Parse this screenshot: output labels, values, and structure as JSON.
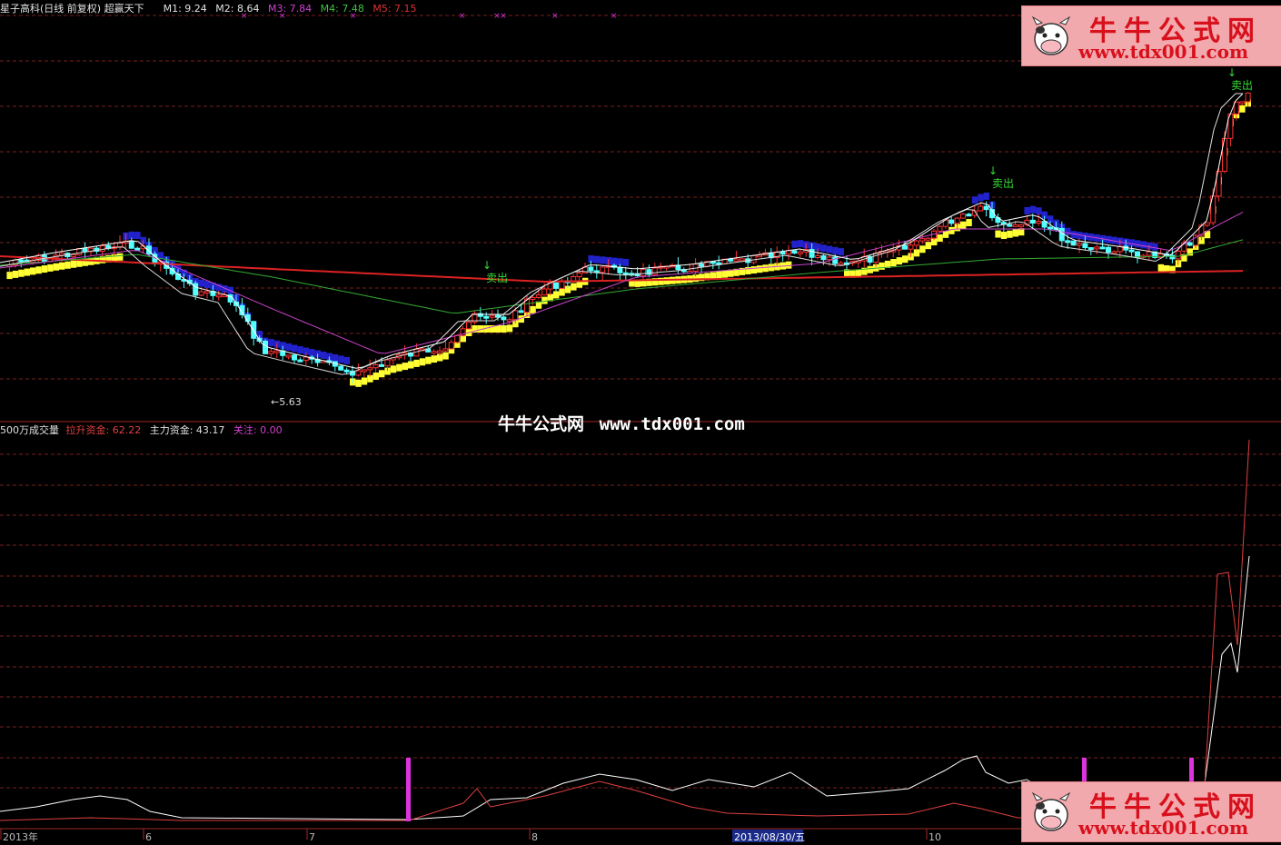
{
  "header": {
    "stock": "星子高科(日线 前复权) 超赢天下",
    "ma": [
      {
        "label": "M1: 9.24",
        "color": "#e0e0e0"
      },
      {
        "label": "M2: 8.64",
        "color": "#e0e0e0"
      },
      {
        "label": "M3: 7.84",
        "color": "#d040d0"
      },
      {
        "label": "M4: 7.48",
        "color": "#40c040"
      },
      {
        "label": "M5: 7.15",
        "color": "#e03030"
      }
    ]
  },
  "sub_header": {
    "name": "500万成交量",
    "items": [
      {
        "label": "拉升资金: 62.22",
        "color": "#e04040"
      },
      {
        "label": "主力资金: 43.17",
        "color": "#e0e0e0"
      },
      {
        "label": "关注: 0.00",
        "color": "#d040d0"
      }
    ]
  },
  "x_axis": {
    "labels": [
      "2013年",
      "6",
      "7",
      "8",
      "10"
    ],
    "cursor_label": "2013/08/30/五"
  },
  "annotations": {
    "sell": "卖出",
    "low_price": "5.63"
  },
  "watermark": {
    "logo_title": "牛牛公式网",
    "logo_url": "www.tdx001.com",
    "center_text": "牛牛公式网",
    "center_url": "www.tdx001.com"
  },
  "colors": {
    "up": "#ff3232",
    "down": "#54ffff",
    "rise_band": "#ffff33",
    "fall_band": "#2222cc",
    "grid": "#7a1f1f",
    "ma_long": "#dd2222",
    "ma_mid": "#33aa33",
    "ma_short": "#cc44cc"
  },
  "chart_data": {
    "type": "candlestick+line",
    "price_panel": {
      "ma_latest": {
        "M1": 9.24,
        "M2": 8.64,
        "M3": 7.84,
        "M4": 7.48,
        "M5": 7.15
      },
      "annotated_low": 5.63,
      "sell_signals": 3
    },
    "indicator_panel": {
      "name": "500万成交量",
      "series": [
        {
          "name": "拉升资金",
          "latest": 62.22
        },
        {
          "name": "主力资金",
          "latest": 43.17
        },
        {
          "name": "关注",
          "latest": 0.0
        }
      ]
    }
  }
}
